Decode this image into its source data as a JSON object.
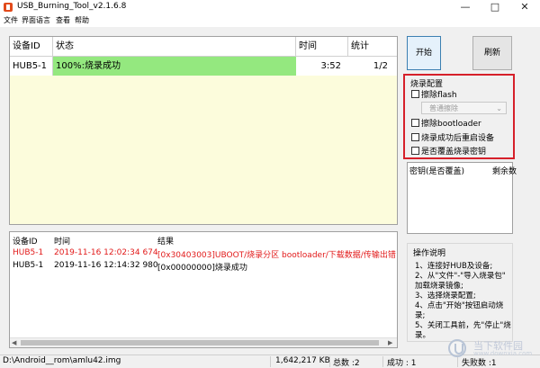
{
  "window": {
    "title": "USB_Burning_Tool_v2.1.6.8",
    "min_glyph": "—",
    "max_glyph": "□",
    "close_glyph": "✕"
  },
  "menu": [
    "文件",
    "界面语言",
    "查看",
    "帮助"
  ],
  "hub_table": {
    "headers": [
      "设备ID",
      "状态",
      "时间",
      "统计"
    ],
    "row": {
      "device": "HUB5-1",
      "status": "100%:烧录成功",
      "time": "3:52",
      "count": "1/2"
    },
    "status_color": "#94e87f"
  },
  "buttons": {
    "start": "开始",
    "flash": "刷新"
  },
  "config": {
    "title": "烧录配置",
    "erase_flash": "擦除flash",
    "erase_mode": "普通擦除",
    "erase_bootloader": "擦除bootloader",
    "reboot_after_success": "烧录成功后重启设备",
    "overwrite_key": "是否覆盖烧录密钥",
    "highlight_color": "#d6202a"
  },
  "key_table": {
    "headers": [
      "密钥(是否覆盖)",
      "剩余数"
    ]
  },
  "log": {
    "headers": [
      "设备ID",
      "时间",
      "结果"
    ],
    "rows": [
      {
        "device": "HUB5-1",
        "time": "2019-11-16 12:02:34 674",
        "result": "[0x30403003]UBOOT/烧录分区 bootloader/下载数据/传输出错",
        "error": true
      },
      {
        "device": "HUB5-1",
        "time": "2019-11-16 12:14:32 980",
        "result": "[0x00000000]烧录成功",
        "error": false
      }
    ]
  },
  "instructions": {
    "title": "操作说明",
    "lines": [
      "1、连接好HUB及设备;",
      "2、从\"文件\"-\"导入烧录包\"",
      "加载烧录镜像;",
      "3、选择烧录配置;",
      "4、点击\"开始\"按钮启动烧",
      "录;",
      "5、关闭工具前，先\"停止\"烧",
      "录。"
    ]
  },
  "statusbar": {
    "path": "D:\\Android__rom\\amlu42.img",
    "size": "1,642,217 KB",
    "total": "总数 :2",
    "success": "成功 : 1",
    "fail": "失败数 :1"
  },
  "watermark": {
    "name": "当下软件园",
    "url": "www.downxia.com"
  }
}
